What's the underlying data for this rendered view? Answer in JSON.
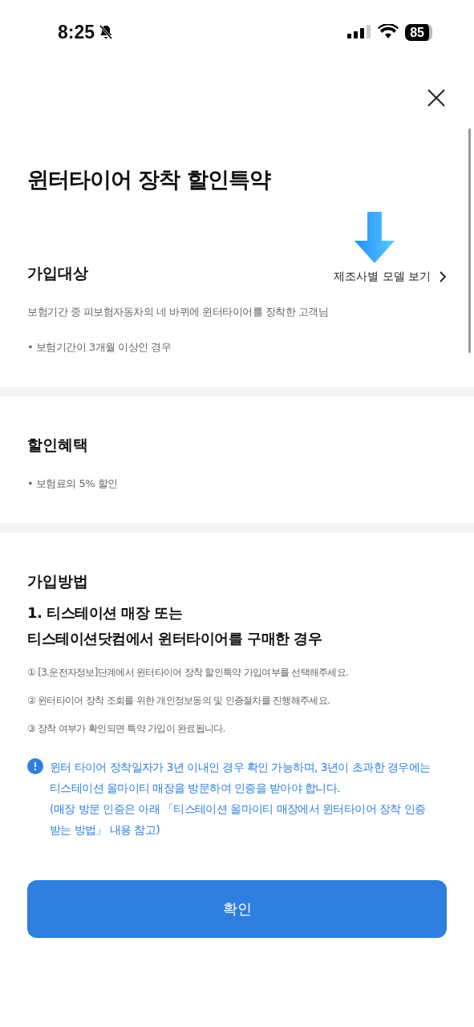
{
  "status_bar": {
    "time": "8:25",
    "battery": "85"
  },
  "title": "윈터타이어 장착 할인특약",
  "sections": [
    {
      "heading": "가입대상",
      "link": "제조사별 모델 보기",
      "lines": [
        {
          "kind": "plain",
          "text": "보험기간 중 피보험자동차의 네 바퀴에 윈터타이어를 장착한 고객님"
        },
        {
          "kind": "plain",
          "text": "• 보험기간이 3개월 이상인 경우"
        }
      ]
    },
    {
      "heading": "할인혜택",
      "lines": [
        {
          "kind": "plain",
          "text": "• 보험료의 5% 할인"
        }
      ]
    },
    {
      "heading": "가입방법",
      "subheading": [
        "1. 티스테이션 매장 또는",
        "티스테이션닷컴에서 윈터타이어를 구매한 경우"
      ],
      "lines": [
        {
          "kind": "plain",
          "text": "① [3.운전자정보]단계에서 윈터타이어 장착 할인특약 가입여부를 선택해주세요."
        },
        {
          "kind": "plain",
          "text": "② 윈터타이어 장착 조회를 위한 개인정보동의 및 인증절차를 진행해주세요."
        },
        {
          "kind": "plain",
          "text": "③ 장착 여부가 확인되면 특약 가입이 완료됩니다."
        }
      ],
      "notice": [
        "윈터 타이어 장착일자가 3년 이내인 경우 확인 가능하며, 3년이 초과한 경우에는 티스테이션 올마이티 매장을 방문하여 인증을 받아야 합니다.",
        "(매장 방문 인증은 아래 「티스테이션 올마이티 매장에서 윈터타이어 장착 인증받는 방법」 내용 참고)"
      ]
    }
  ],
  "button": "확인"
}
